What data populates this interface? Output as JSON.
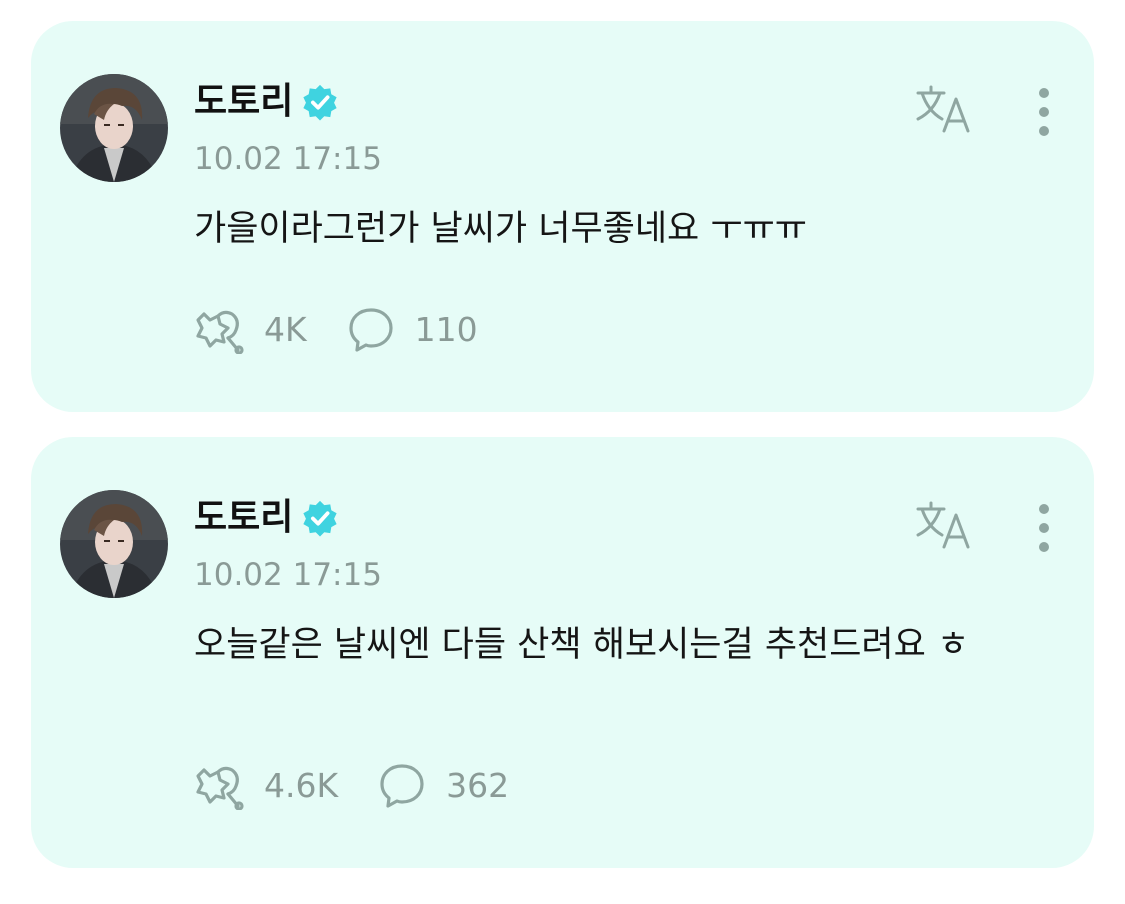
{
  "colors": {
    "card_background": "#e6fcf7",
    "verified_badge": "#3fd3e0",
    "muted_text": "#8a9a96",
    "icon_color": "#8fa6a1"
  },
  "posts": [
    {
      "author": "도토리",
      "verified": true,
      "timestamp": "10.02 17:15",
      "text": "가을이라그런가 날씨가 너무좋네요 ㅜㅠㅠ",
      "likes": "4K",
      "comments": "110",
      "icons": [
        "avatar",
        "verified-icon",
        "translate-icon",
        "more-vertical-icon",
        "like-icon",
        "comment-icon"
      ]
    },
    {
      "author": "도토리",
      "verified": true,
      "timestamp": "10.02 17:15",
      "text": "오늘같은 날씨엔 다들 산책 해보시는걸 추천드려요 ㅎ",
      "likes": "4.6K",
      "comments": "362",
      "icons": [
        "avatar",
        "verified-icon",
        "translate-icon",
        "more-vertical-icon",
        "like-icon",
        "comment-icon"
      ]
    }
  ]
}
